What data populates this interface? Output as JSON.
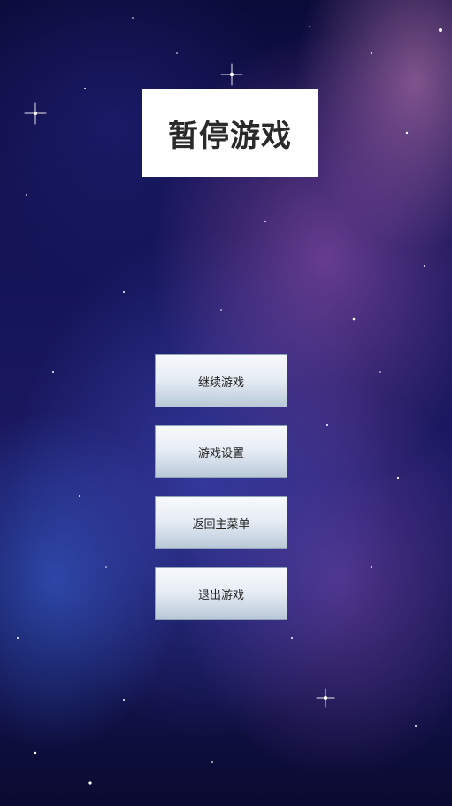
{
  "screen": {
    "title": "暂停游戏"
  },
  "menu": {
    "buttons": [
      {
        "label": "继续游戏"
      },
      {
        "label": "游戏设置"
      },
      {
        "label": "返回主菜单"
      },
      {
        "label": "退出游戏"
      }
    ]
  },
  "colors": {
    "title_text": "#2a2a2a",
    "button_text": "#222222",
    "background": "#141458"
  }
}
